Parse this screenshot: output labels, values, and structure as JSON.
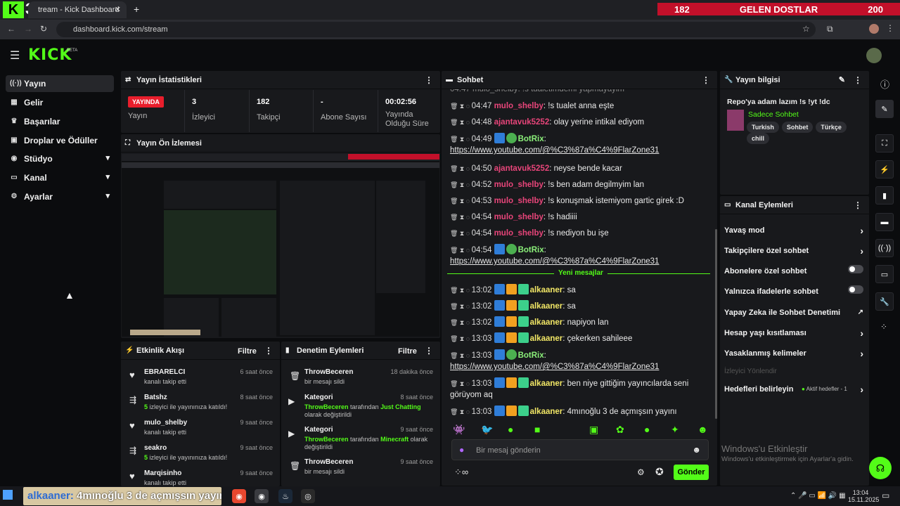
{
  "browser": {
    "tab_title": "tream - Kick Dashboard",
    "url": "dashboard.kick.com/stream",
    "overlay_left": "182",
    "overlay_title": "GELEN DOSTLAR",
    "overlay_right": "200",
    "overlay_num": "3"
  },
  "brand": {
    "logo": "KICK",
    "beta": "BETA"
  },
  "sidebar": {
    "items": [
      {
        "label": "Yayın",
        "icon": "broadcast-icon"
      },
      {
        "label": "Gelir",
        "icon": "revenue-icon"
      },
      {
        "label": "Başarılar",
        "icon": "trophy-icon"
      },
      {
        "label": "Droplar ve Ödüller",
        "icon": "gift-icon"
      },
      {
        "label": "Stüdyo",
        "icon": "studio-icon"
      },
      {
        "label": "Kanal",
        "icon": "channel-icon"
      },
      {
        "label": "Ayarlar",
        "icon": "gear-icon"
      }
    ]
  },
  "stats": {
    "title": "Yayın İstatistikleri",
    "live": "YAYINDA",
    "live_label": "Yayın",
    "viewers": "3",
    "viewers_label": "İzleyici",
    "followers": "182",
    "followers_label": "Takipçi",
    "subs": "-",
    "subs_label": "Abone Sayısı",
    "uptime": "00:02:56",
    "uptime_label": "Yayında Olduğu Süre"
  },
  "preview": {
    "title": "Yayın Ön İzlemesi"
  },
  "activity": {
    "title": "Etkinlik Akışı",
    "filter": "Filtre",
    "items": [
      {
        "name": "EBRARELCI",
        "sub": "kanalı takip etti",
        "time": "6 saat önce"
      },
      {
        "name": "Batshz",
        "count": "5",
        "sub": "izleyici ile yayınınıza katıldı!",
        "time": "8 saat önce"
      },
      {
        "name": "mulo_shelby",
        "sub": "kanalı takip etti",
        "time": "9 saat önce"
      },
      {
        "name": "seakro",
        "count": "5",
        "sub": "izleyici ile yayınınıza katıldı!",
        "time": "9 saat önce"
      },
      {
        "name": "Marqisinho",
        "sub": "kanalı takip etti",
        "time": "9 saat önce"
      }
    ]
  },
  "moderation": {
    "title": "Denetim Eylemleri",
    "filter": "Filtre",
    "items": [
      {
        "name": "ThrowBeceren",
        "sub": "bir mesajı sildi",
        "time": "18 dakika önce"
      },
      {
        "name": "Kategori",
        "actor": "ThrowBeceren",
        "mid": "tarafından",
        "cat": "Just Chatting",
        "tail": "olarak değiştirildi",
        "time": "8 saat önce"
      },
      {
        "name": "Kategori",
        "actor": "ThrowBeceren",
        "mid": "tarafından",
        "cat": "Minecraft",
        "tail": "olarak değiştirildi",
        "time": "9 saat önce"
      },
      {
        "name": "ThrowBeceren",
        "sub": "bir mesajı sildi",
        "time": "9 saat önce"
      }
    ]
  },
  "chat": {
    "title": "Sohbet",
    "new_messages": "Yeni mesajlar",
    "placeholder": "Bir mesaj gönderin",
    "send": "Gönder",
    "lines": [
      {
        "time": "04:47",
        "user": "mulo_shelby",
        "msg": "!s tualet anna eşte",
        "color": "red"
      },
      {
        "time": "04:48",
        "user": "ajantavuk5252",
        "msg": "olay yerine intikal ediyom",
        "color": "red"
      },
      {
        "time": "04:49",
        "user": "BotRix",
        "msg": "",
        "link": "https://www.youtube.com/@%C3%87a%C4%9FlarZone31",
        "color": "green"
      },
      {
        "time": "04:50",
        "user": "ajantavuk5252",
        "msg": "neyse bende kacar",
        "color": "red"
      },
      {
        "time": "04:52",
        "user": "mulo_shelby",
        "msg": "!s ben adam degilmyim lan",
        "color": "red"
      },
      {
        "time": "04:53",
        "user": "mulo_shelby",
        "msg": "!s konuşmak istemiyom gartic girek :D",
        "color": "red"
      },
      {
        "time": "04:54",
        "user": "mulo_shelby",
        "msg": "!s hadiiii",
        "color": "red"
      },
      {
        "time": "04:54",
        "user": "mulo_shelby",
        "msg": "!s nediyon bu işe",
        "color": "red"
      },
      {
        "time": "04:54",
        "user": "BotRix",
        "msg": "",
        "link": "https://www.youtube.com/@%C3%87a%C4%9FlarZone31",
        "color": "green"
      },
      {
        "time": "13:02",
        "user": "alkaaner",
        "msg": "sa",
        "color": "yellow"
      },
      {
        "time": "13:02",
        "user": "alkaaner",
        "msg": "sa",
        "color": "yellow"
      },
      {
        "time": "13:02",
        "user": "alkaaner",
        "msg": "napiyon lan",
        "color": "yellow"
      },
      {
        "time": "13:03",
        "user": "alkaaner",
        "msg": "çekerken sahileee",
        "color": "yellow"
      },
      {
        "time": "13:03",
        "user": "BotRix",
        "msg": "",
        "link": "https://www.youtube.com/@%C3%87a%C4%9FlarZone31",
        "color": "green"
      },
      {
        "time": "13:03",
        "user": "alkaaner",
        "msg": "ben niye gittiğim yayıncılarda seni görüyom aq",
        "color": "yellow"
      },
      {
        "time": "13:03",
        "user": "alkaaner",
        "msg": "4mınoğlu 3 de açmışsın yayını",
        "color": "yellow"
      }
    ],
    "partial_top": "04:47 mulo_shelby: !s tualetimdemi yapmayayim"
  },
  "info": {
    "title": "Yayın bilgisi",
    "stream_title": "Repo'ya adam lazım !s !yt !dc",
    "category": "Sadece Sohbet",
    "tags": [
      "Turkish",
      "Sohbet",
      "Türkçe",
      "chill"
    ]
  },
  "channel_actions": {
    "title": "Kanal Eylemleri",
    "items": [
      {
        "label": "Yavaş mod",
        "kind": "chevron"
      },
      {
        "label": "Takipçilere özel sohbet",
        "kind": "chevron"
      },
      {
        "label": "Abonelere özel sohbet",
        "kind": "toggle"
      },
      {
        "label": "Yalnızca ifadelerle sohbet",
        "kind": "toggle"
      },
      {
        "label": "Yapay Zeka ile Sohbet Denetimi",
        "kind": "ext"
      },
      {
        "label": "Hesap yaşı kısıtlaması",
        "kind": "chevron"
      },
      {
        "label": "Yasaklanmış kelimeler",
        "kind": "chevron"
      }
    ],
    "faded": "İzleyici Yönlendir",
    "goals": "Hedefleri belirleyin",
    "goals_status": "Aktif hedefler - 1"
  },
  "windows": {
    "activate_title": "Windows'u Etkinleştir",
    "activate_sub": "Windows'u etkinleştirmek için Ayarlar'a gidin."
  },
  "ticker": {
    "user": "alkaaner:",
    "msg": "4mınoğlu 3 de açmışsın yayım"
  },
  "clock": {
    "time": "13:04",
    "date": "15.11.2025"
  }
}
